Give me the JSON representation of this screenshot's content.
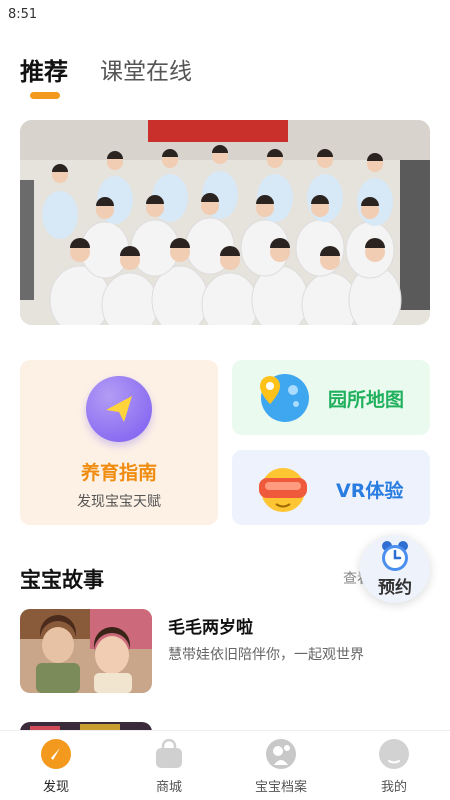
{
  "status_bar": {
    "time": "8:51"
  },
  "top_tabs": [
    {
      "label": "推荐",
      "active": true
    },
    {
      "label": "课堂在线",
      "active": false
    }
  ],
  "banner": {
    "alt_icon": "group-photo-banner"
  },
  "features": {
    "guide": {
      "title": "养育指南",
      "subtitle": "发现宝宝天赋",
      "icon": "paper-plane-icon"
    },
    "map": {
      "title": "园所地图",
      "icon": "map-pin-icon"
    },
    "vr": {
      "title": "VR体验",
      "icon": "vr-goggles-icon"
    }
  },
  "stories_section": {
    "title": "宝宝故事",
    "more_label": "查看"
  },
  "fab": {
    "label": "预约",
    "icon": "alarm-clock-icon"
  },
  "stories": [
    {
      "title": "毛毛两岁啦",
      "description": "慧带娃依旧陪伴你，一起观世界"
    },
    {
      "title": "",
      "description": ""
    }
  ],
  "bottom_nav": [
    {
      "label": "发现",
      "icon": "compass-icon",
      "active": true
    },
    {
      "label": "商城",
      "icon": "shopping-bag-icon",
      "active": false
    },
    {
      "label": "宝宝档案",
      "icon": "baby-profile-icon",
      "active": false
    },
    {
      "label": "我的",
      "icon": "user-avatar-icon",
      "active": false
    }
  ],
  "colors": {
    "accent": "#f39a1e",
    "guide_title": "#f08c10",
    "map_title": "#21b15e",
    "vr_title": "#2a7de0"
  }
}
